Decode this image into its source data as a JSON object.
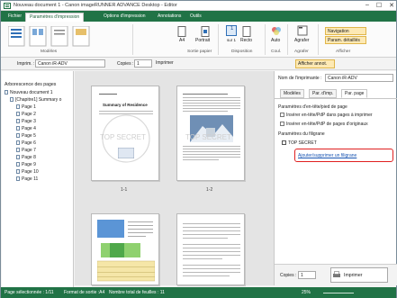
{
  "window": {
    "title": "Nouveau document 1 - Canon imageRUNNER ADVANCE Desktop - Editor",
    "controls": {
      "minimize": "–",
      "maximize": "☐",
      "close": "✕"
    }
  },
  "ribbon_tabs": [
    "Fichier",
    "Paramètres d'impression",
    "Options d'impression",
    "Annotations",
    "Outils"
  ],
  "ribbon": {
    "groups": {
      "modeles": "Modèles",
      "sortie_papier": "Sortie papier",
      "disposition": "Disposition",
      "coul": "Coul.",
      "agrafer": "Agrafer",
      "afficher": "Afficher"
    },
    "buttons": {
      "a4": "A4",
      "portrait": "Portrait",
      "page_count": "1",
      "sur": "sur 1",
      "recto": "Recto",
      "auto": "Auto",
      "agrafer": "Agrafer",
      "navigation": "Navigation",
      "param_details": "Param. détaillés"
    }
  },
  "toolbar": {
    "imprim_label": "Imprim. :",
    "printer_value": "Canon iR-ADV",
    "copies_label": "Copies :",
    "copies_value": "1",
    "imprimer": "Imprimer",
    "afficher_annot": "Afficher annot."
  },
  "left_panel": {
    "header": "Arborescence des pages",
    "tree": {
      "document": "Nouveau document 1",
      "chapter": "[Chapitre1] Summary o",
      "pages": [
        "Page 1",
        "Page 2",
        "Page 3",
        "Page 4",
        "Page 5",
        "Page 6",
        "Page 7",
        "Page 8",
        "Page 9",
        "Page 10",
        "Page 11"
      ]
    }
  },
  "center": {
    "page1": {
      "heading": "Summary of Residence",
      "watermark": "TOP SECRET",
      "label": "1-1"
    },
    "page2": {
      "watermark": "TOP SECRET",
      "label": "1-2"
    }
  },
  "right_panel": {
    "printer_label": "Nom de l'imprimante :",
    "printer_value": "Canon iR-ADV",
    "tabs": [
      "Modèles",
      "Par. d'imp.",
      "Par. page"
    ],
    "section_header": "Paramètres d'en-tête/pied de page",
    "checkbox1": "Insérer en-tête/PdP dans pages à imprimer",
    "checkbox2": "Insérer en-tête/PdP de pages d'originaux",
    "watermark_section": "Paramètres du filigrane",
    "watermark_item": "TOP SECRET",
    "add_link": "Ajouter/supprimer un filigrane",
    "copies_label": "Copies :",
    "copies_value": "1",
    "print_button": "Imprimer"
  },
  "status_bar": {
    "selected": "Page sélectionnée : 1/11",
    "format": "Format de sortie :A4",
    "total": "Nombre total de feuilles : 11",
    "zoom": "25%"
  },
  "colors": {
    "accent": "#217346",
    "highlight_box": "#e02020",
    "link": "#1a56b3"
  }
}
